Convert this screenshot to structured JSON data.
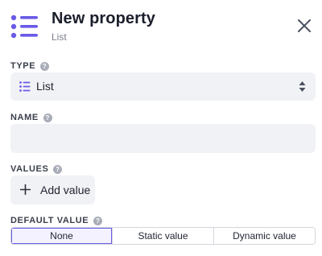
{
  "header": {
    "title": "New property",
    "subtitle": "List",
    "icon": "list-icon",
    "close_icon": "close-icon"
  },
  "type": {
    "label": "TYPE",
    "help_icon": "help-icon",
    "selected": "List",
    "selected_icon": "list-icon"
  },
  "name": {
    "label": "NAME",
    "value": "",
    "placeholder": ""
  },
  "values": {
    "label": "VALUES",
    "add_label": "Add value",
    "add_icon": "plus-icon"
  },
  "default_value": {
    "label": "DEFAULT VALUE",
    "options": [
      "None",
      "Static value",
      "Dynamic value"
    ],
    "selected": "None"
  },
  "colors": {
    "accent": "#6a5be6",
    "field_bg": "#f1f2f5"
  }
}
